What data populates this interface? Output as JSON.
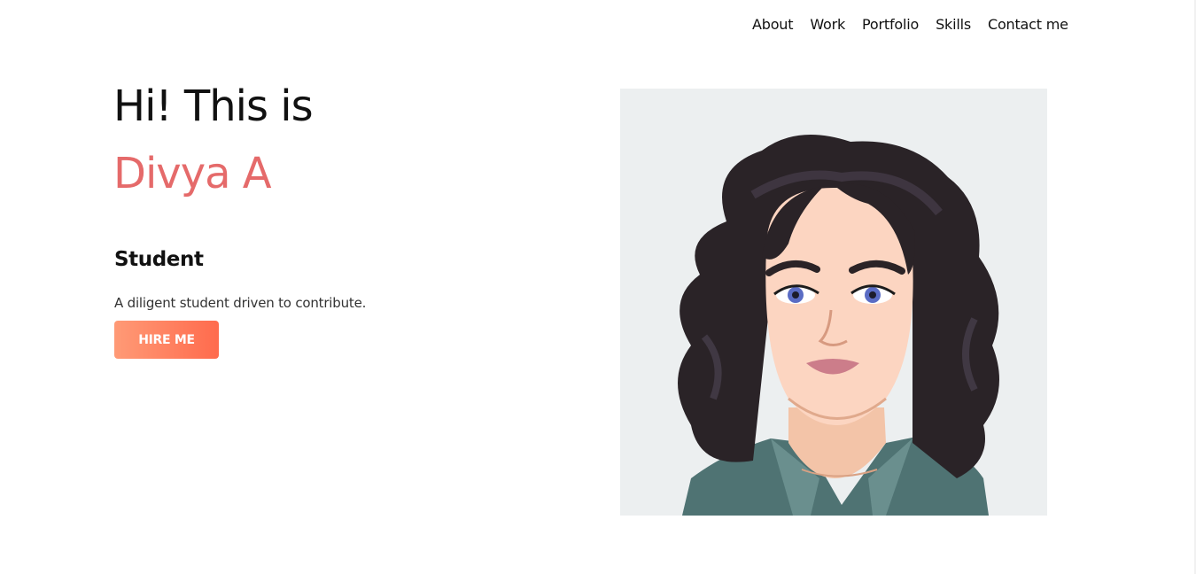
{
  "nav": {
    "items": [
      "About",
      "Work",
      "Portfolio",
      "Skills",
      "Contact me"
    ]
  },
  "hero": {
    "greeting": "Hi! This is",
    "name": "Divya A",
    "role": "Student",
    "description": "A diligent student driven to contribute.",
    "cta_label": "HIRE ME"
  },
  "colors": {
    "accent": "#e56a6a",
    "button_start": "#ff9a76",
    "button_end": "#ff6b4d",
    "avatar_bg": "#eceff0"
  },
  "icons": {
    "avatar": "cartoon-woman-portrait"
  }
}
